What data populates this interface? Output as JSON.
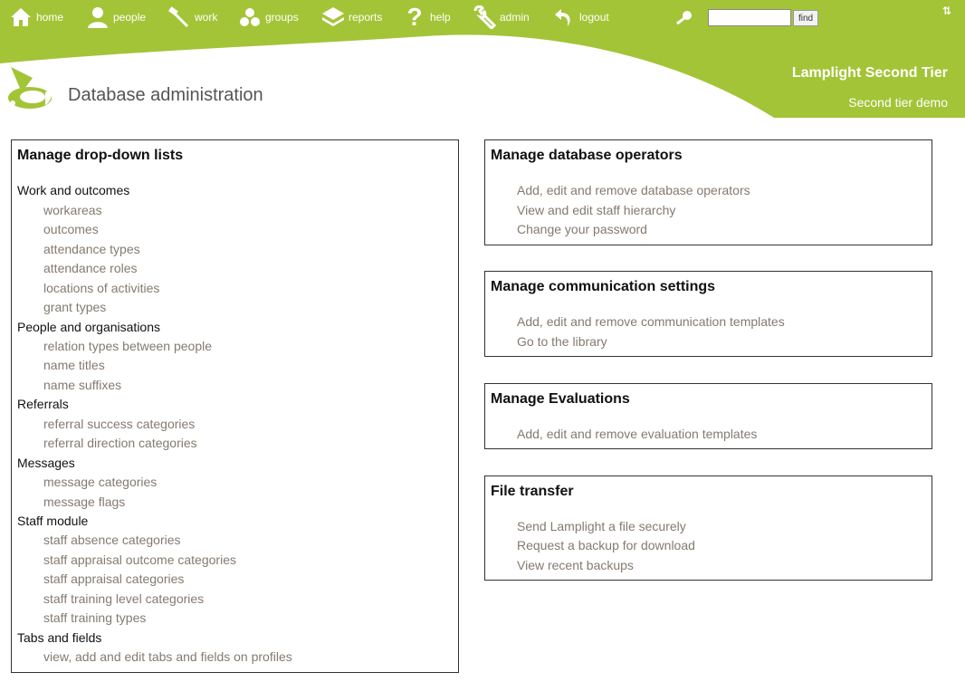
{
  "nav": {
    "items": [
      {
        "label": "home",
        "icon": "house-icon"
      },
      {
        "label": "people",
        "icon": "person-icon"
      },
      {
        "label": "work",
        "icon": "hammer-icon"
      },
      {
        "label": "groups",
        "icon": "groups-icon"
      },
      {
        "label": "reports",
        "icon": "reports-icon"
      },
      {
        "label": "help",
        "icon": "question-icon"
      },
      {
        "label": "admin",
        "icon": "wrench-icon"
      },
      {
        "label": "logout",
        "icon": "undo-arrow-icon"
      }
    ],
    "search_placeholder": "",
    "find_label": "find",
    "sort_symbol": "⇅"
  },
  "header": {
    "page_title": "Database administration",
    "org_name": "Lamplight Second Tier",
    "org_subtitle": "Second tier demo"
  },
  "colors": {
    "brand_green": "#a3c437",
    "link": "#857a6f"
  },
  "lists_panel": {
    "title": "Manage drop-down lists",
    "groups": [
      {
        "label": "Work and outcomes",
        "items": [
          "workareas",
          "outcomes",
          "attendance types",
          "attendance roles",
          "locations of activities",
          "grant types"
        ]
      },
      {
        "label": "People and organisations",
        "items": [
          "relation types between people",
          "name titles",
          "name suffixes"
        ]
      },
      {
        "label": "Referrals",
        "items": [
          "referral success categories",
          "referral direction categories"
        ]
      },
      {
        "label": "Messages",
        "items": [
          "message categories",
          "message flags"
        ]
      },
      {
        "label": "Staff module",
        "items": [
          "staff absence categories",
          "staff appraisal outcome categories",
          "staff appraisal categories",
          "staff training level categories",
          "staff training types"
        ]
      },
      {
        "label": "Tabs and fields",
        "items": [
          "view, add and edit tabs and fields on profiles"
        ]
      }
    ]
  },
  "operators_panel": {
    "title": "Manage database operators",
    "links": [
      "Add, edit and remove database operators",
      "View and edit staff hierarchy",
      "Change your password"
    ]
  },
  "communication_panel": {
    "title": "Manage communication settings",
    "links": [
      "Add, edit and remove communication templates",
      "Go to the library"
    ]
  },
  "evaluations_panel": {
    "title": "Manage Evaluations",
    "links": [
      "Add, edit and remove evaluation templates"
    ]
  },
  "file_panel": {
    "title": "File transfer",
    "links": [
      "Send Lamplight a file securely",
      "Request a backup for download",
      "View recent backups"
    ]
  }
}
